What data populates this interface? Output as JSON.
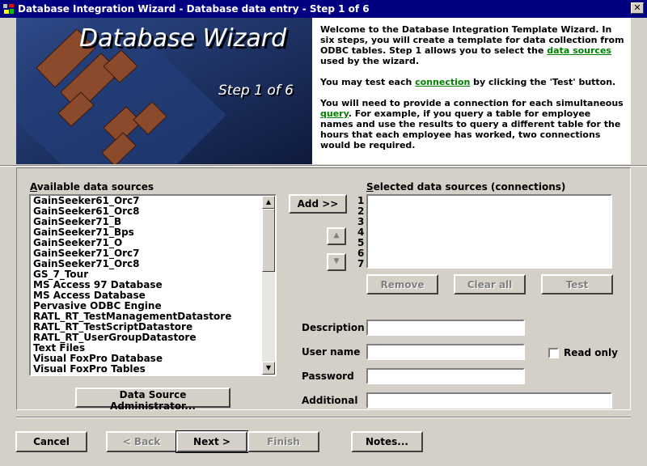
{
  "window": {
    "title": "Database Integration Wizard - Database data entry - Step 1 of 6",
    "close_glyph": "✕"
  },
  "banner": {
    "title": "Database Wizard",
    "step": "Step 1 of 6",
    "colors": {
      "background": "#1a2b58",
      "logo": "#8b4a2b"
    }
  },
  "welcome": {
    "p1_a": "Welcome to the Database Integration Template Wizard.  In six steps, you will create a template for data collection from ODBC tables.  Step 1 allows you to select the ",
    "p1_link": "data sources",
    "p1_b": " used by the wizard.",
    "p2_a": "You may test each ",
    "p2_link": "connection",
    "p2_b": " by clicking the 'Test' button.",
    "p3_a": "You will need to provide a connection for each simultaneous ",
    "p3_link": "query",
    "p3_b": ".  For example, if you query a table for employee names and use the results to query a different table for the hours that each employee has worked, two connections would be required."
  },
  "available": {
    "label_first": "A",
    "label_rest": "vailable data sources",
    "items": [
      "GainSeeker61_Orc7",
      "GainSeeker61_Orc8",
      "GainSeeker71_B",
      "GainSeeker71_Bps",
      "GainSeeker71_O",
      "GainSeeker71_Orc7",
      "GainSeeker71_Orc8",
      "GS_7_Tour",
      "MS Access 97 Database",
      "MS Access Database",
      "Pervasive ODBC Engine",
      "RATL_RT_TestManagementDatastore",
      "RATL_RT_TestScriptDatastore",
      "RATL_RT_UserGroupDatastore",
      "Text Files",
      "Visual FoxPro Database",
      "Visual FoxPro Tables"
    ],
    "admin_button": "Data Source Administrator..."
  },
  "selected": {
    "label_first": "S",
    "label_rest": "elected data sources (connections)",
    "numbers": [
      "1",
      "2",
      "3",
      "4",
      "5",
      "6",
      "7"
    ]
  },
  "buttons": {
    "add": "Add >>",
    "up_glyph": "▲",
    "down_glyph": "▼",
    "remove": "Remove",
    "clear_all": "Clear all",
    "test": "Test"
  },
  "fields": {
    "description_label": "Description",
    "description_value": "",
    "username_label": "User name",
    "username_value": "",
    "password_label": "Password",
    "password_value": "",
    "additional_label": "Additional",
    "additional_value": "",
    "readonly_label": "Read only"
  },
  "footer": {
    "cancel": "Cancel",
    "back": "< Back",
    "next": "Next >",
    "finish": "Finish",
    "notes": "Notes..."
  }
}
